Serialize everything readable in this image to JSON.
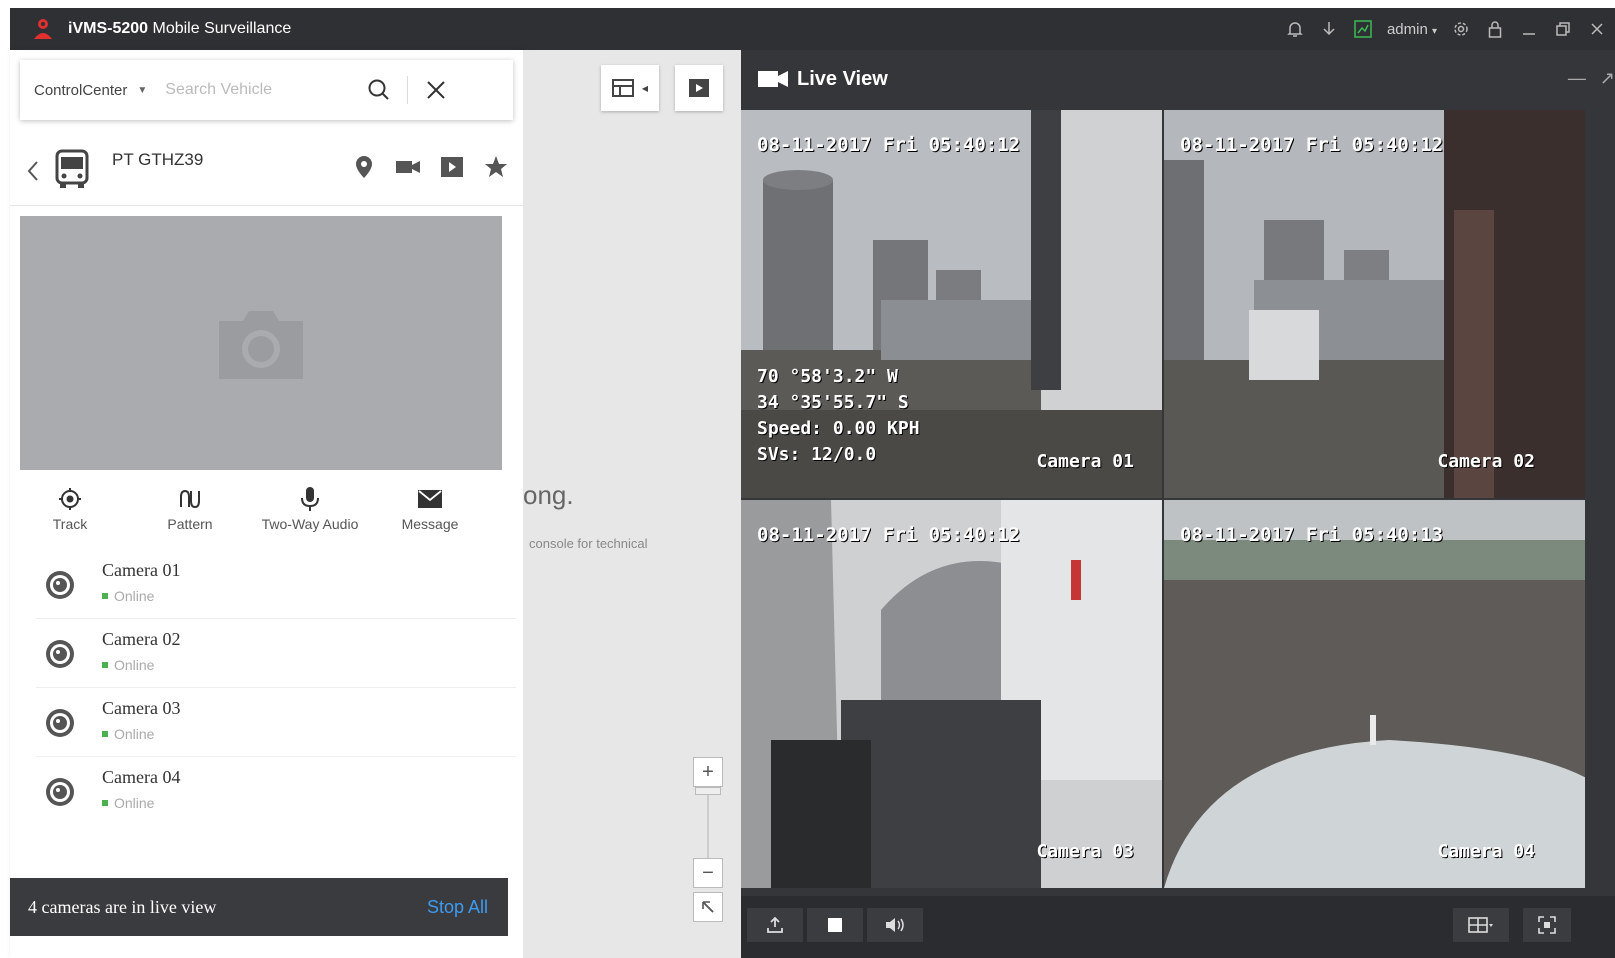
{
  "titlebar": {
    "app_name": "iVMS-5200",
    "app_suffix": "Mobile Surveillance",
    "user": "admin"
  },
  "search": {
    "scope": "ControlCenter",
    "placeholder": "Search Vehicle"
  },
  "vehicle": {
    "name": "PT GTHZ39"
  },
  "functions": [
    {
      "label": "Track",
      "icon": "target-icon"
    },
    {
      "label": "Pattern",
      "icon": "pattern-icon"
    },
    {
      "label": "Two-Way Audio",
      "icon": "microphone-icon"
    },
    {
      "label": "Message",
      "icon": "envelope-icon"
    }
  ],
  "cameras": [
    {
      "name": "Camera 01",
      "status": "Online"
    },
    {
      "name": "Camera 02",
      "status": "Online"
    },
    {
      "name": "Camera 03",
      "status": "Online"
    },
    {
      "name": "Camera 04",
      "status": "Online"
    }
  ],
  "bottom_bar": {
    "message": "4 cameras are in live view",
    "stop_label": "Stop All"
  },
  "map": {
    "partial_text": "ong.",
    "partial_subtext": "console for technical"
  },
  "live_view": {
    "title": "Live View",
    "feeds": [
      {
        "timestamp": "08-11-2017 Fri 05:40:12",
        "label": "Camera 01",
        "osd": "70 °58'3.2\" W\n34 °35'55.7\" S\nSpeed: 0.00 KPH\nSVs: 12/0.0"
      },
      {
        "timestamp": "08-11-2017 Fri 05:40:12",
        "label": "Camera 02"
      },
      {
        "timestamp": "08-11-2017 Fri 05:40:12",
        "label": "Camera 03"
      },
      {
        "timestamp": "08-11-2017 Fri 05:40:13",
        "label": "Camera 04"
      }
    ]
  },
  "colors": {
    "titlebar": "#2f3033",
    "accent_red": "#e03030",
    "link_blue": "#3d9bf2",
    "online_green": "#4caf50"
  }
}
